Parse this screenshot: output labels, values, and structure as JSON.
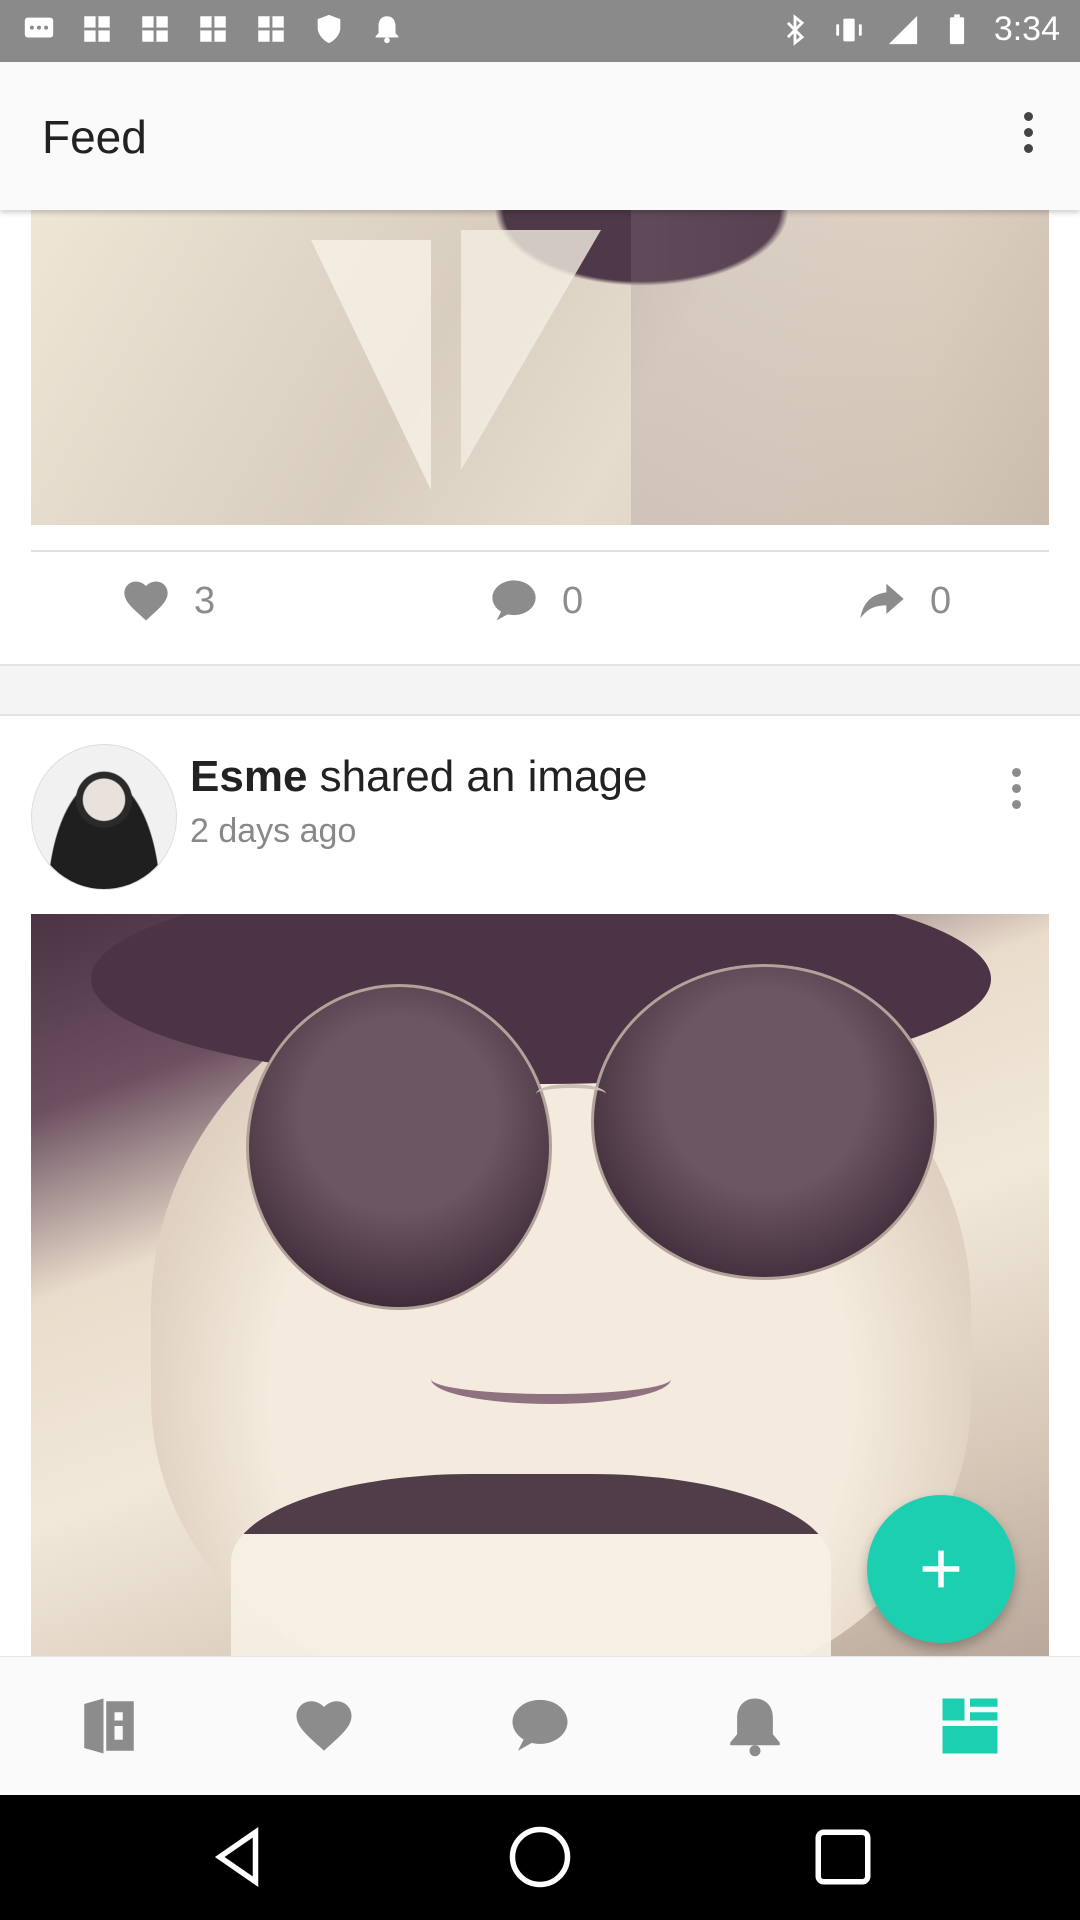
{
  "status_bar": {
    "time": "3:34",
    "left_icons": [
      "message-icon",
      "gallery-icon",
      "gallery-icon",
      "gallery-icon",
      "gallery-icon",
      "shield-icon",
      "notification-bell-icon"
    ],
    "right_icons": [
      "bluetooth-icon",
      "vibrate-icon",
      "signal-icon",
      "battery-icon"
    ]
  },
  "app_bar": {
    "title": "Feed",
    "menu_icon": "more-vert-icon"
  },
  "previous_post": {
    "likes": "3",
    "comments": "0",
    "shares": "0"
  },
  "post": {
    "author": "Esme",
    "action_text": "shared an image",
    "time_ago": "2 days ago",
    "menu_icon": "more-vert-icon"
  },
  "fab": {
    "icon": "plus-icon",
    "color": "#1dcfb1"
  },
  "bottom_nav": {
    "items": [
      {
        "icon": "door-icon"
      },
      {
        "icon": "heart-icon"
      },
      {
        "icon": "chat-icon"
      },
      {
        "icon": "bell-icon"
      },
      {
        "icon": "feed-icon",
        "active": true
      }
    ],
    "active_color": "#1dcfb1",
    "inactive_color": "#8c8c8c"
  },
  "system_nav": [
    "back-icon",
    "home-icon",
    "recents-icon"
  ]
}
